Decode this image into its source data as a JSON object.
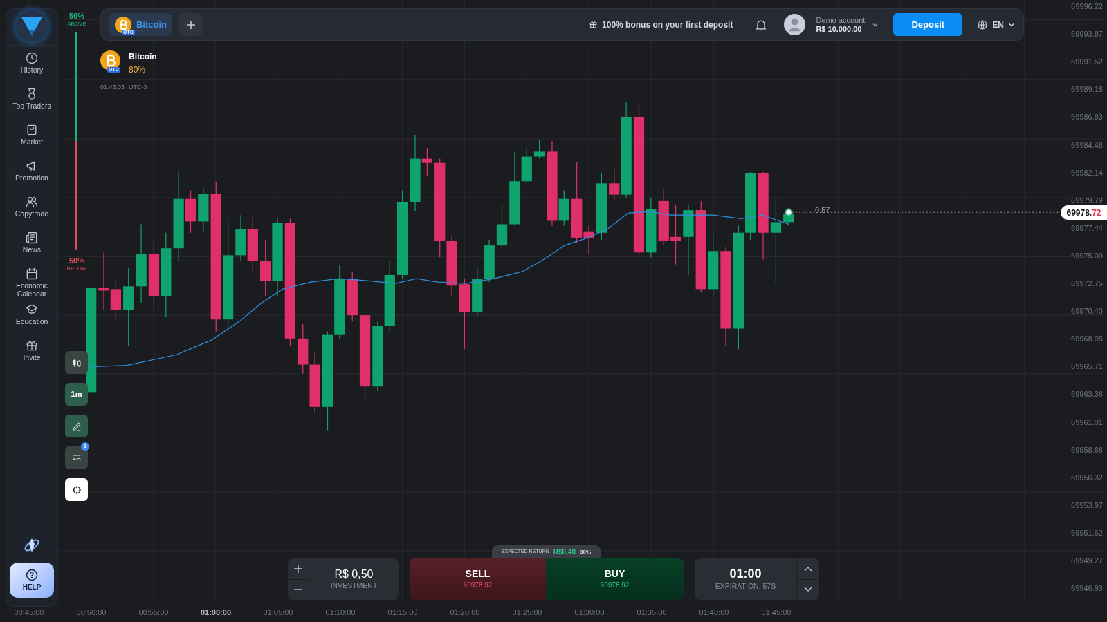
{
  "sidebar": {
    "items": [
      {
        "label": "History",
        "kind": "history",
        "selected": false
      },
      {
        "label": "Top Traders",
        "kind": "medal",
        "selected": false
      },
      {
        "label": "Market",
        "kind": "market",
        "selected": false
      },
      {
        "label": "Promotion",
        "kind": "promotion",
        "selected": false
      },
      {
        "label": "Copytrade",
        "kind": "copytrade",
        "selected": false
      },
      {
        "label": "News",
        "kind": "news",
        "selected": false
      },
      {
        "label": "Economic Calendar",
        "kind": "calendar",
        "selected": false
      },
      {
        "label": "Education",
        "kind": "education",
        "selected": false
      },
      {
        "label": "Invite",
        "kind": "invite",
        "selected": false
      }
    ],
    "help_button": "HELP"
  },
  "sentiment": {
    "above": "50%",
    "above_label": "ABOVE",
    "below": "50%",
    "below_label": "BELOW",
    "level": 0.5
  },
  "topbar": {
    "asset_tab": {
      "name": "Bitcoin",
      "badge": "OTC",
      "selected": true
    },
    "bonus": "100% bonus on your first deposit",
    "account": {
      "label": "Demo account",
      "balance": "R$ 10.000,00"
    },
    "deposit_button": "Deposit",
    "language": "EN"
  },
  "asset": {
    "name": "Bitcoin",
    "badge": "OTC",
    "payout": "80%",
    "time": "01:46:03",
    "timezone": "UTC-3"
  },
  "tools": [
    {
      "kind": "candles",
      "selected": false
    },
    {
      "kind": "interval",
      "label": "1m",
      "selected": false
    },
    {
      "kind": "draw",
      "selected": false
    },
    {
      "kind": "indicator",
      "badge": "1",
      "selected": false
    },
    {
      "kind": "crosshair",
      "selected": true
    }
  ],
  "chart": {
    "yticks": [
      "69996.22",
      "69993.87",
      "69991.52",
      "69989.18",
      "69986.83",
      "69984.48",
      "69982.14",
      "69979.79",
      "69977.44",
      "69975.09",
      "69972.75",
      "69970.40",
      "69968.05",
      "69965.71",
      "69963.36",
      "69961.01",
      "69958.66",
      "69956.32",
      "69953.97",
      "69951.62",
      "69949.27",
      "69946.93"
    ],
    "xticks": [
      {
        "label": "00:45:00",
        "emphasized": false
      },
      {
        "label": "00:50:00",
        "emphasized": false
      },
      {
        "label": "00:55:00",
        "emphasized": false
      },
      {
        "label": "01:00:00",
        "emphasized": true
      },
      {
        "label": "01:05:00",
        "emphasized": false
      },
      {
        "label": "01:10:00",
        "emphasized": false
      },
      {
        "label": "01:15:00",
        "emphasized": false
      },
      {
        "label": "01:20:00",
        "emphasized": false
      },
      {
        "label": "01:25:00",
        "emphasized": false
      },
      {
        "label": "01:30:00",
        "emphasized": false
      },
      {
        "label": "01:35:00",
        "emphasized": false
      },
      {
        "label": "01:40:00",
        "emphasized": false
      },
      {
        "label": "01:45:00",
        "emphasized": false
      }
    ],
    "timer": "0:57",
    "price": {
      "whole": "69978.",
      "decimals": "72"
    }
  },
  "trade": {
    "investment": {
      "value": "R$ 0,50",
      "label": "INVESTMENT"
    },
    "expected_return": {
      "label": "EXPECTED RETURN",
      "amount": "R$0,40",
      "percent": "80%"
    },
    "sell": {
      "label": "SELL",
      "price": "69978.92"
    },
    "buy": {
      "label": "BUY",
      "price": "69978.92"
    },
    "expiration": {
      "value": "01:00",
      "label": "EXPIRATION: 57S"
    }
  }
}
